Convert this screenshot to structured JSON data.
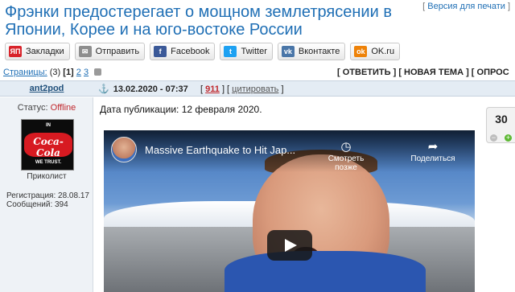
{
  "topic": {
    "title": "Фрэнки предостерегает о мощном землетрясении в Японии, Корее и на юго-востоке России",
    "print_left": "[",
    "print_link": "Версия для печати",
    "print_right": "]"
  },
  "share": [
    {
      "label": "Закладки",
      "icon": "yandex-bookmarks-icon",
      "icon_text": "ЯП",
      "color": "#d8232a"
    },
    {
      "label": "Отправить",
      "icon": "mail-icon",
      "icon_text": "✉",
      "color": "#8e8e8e"
    },
    {
      "label": "Facebook",
      "icon": "facebook-icon",
      "icon_text": "f",
      "color": "#3b5998"
    },
    {
      "label": "Twitter",
      "icon": "twitter-icon",
      "icon_text": "t",
      "color": "#1da1f2"
    },
    {
      "label": "Вконтакте",
      "icon": "vk-icon",
      "icon_text": "vk",
      "color": "#4a76a8"
    },
    {
      "label": "OK.ru",
      "icon": "odnoklassniki-icon",
      "icon_text": "ok",
      "color": "#ee8208"
    }
  ],
  "pager": {
    "label": "Страницы:",
    "total": "(3)",
    "current": "[1]",
    "page2": "2",
    "page3": "3"
  },
  "actions": {
    "reply": "ОТВЕТИТЬ",
    "new_topic": "НОВАЯ ТЕМА",
    "poll": "ОПРОС"
  },
  "post": {
    "author": "ant2pod",
    "anchor": "⚓",
    "date": "13.02.2020 - 07:37",
    "number": "911",
    "quote": "цитировать",
    "status_label": "Статус:",
    "status_value": "Offline",
    "rank": "Приколист",
    "registration": "Регистрация: 28.08.17",
    "messages": "Сообщений: 394",
    "publication": "Дата публикации: 12 февраля 2020.",
    "rating": "30"
  },
  "avatar": {
    "line1": "IN",
    "brand": "Coca-Cola",
    "line2": "WE TRUST."
  },
  "video": {
    "title": "Massive Earthquake to Hit Jap...",
    "watch_later": "Смотреть позже",
    "share": "Поделиться"
  }
}
